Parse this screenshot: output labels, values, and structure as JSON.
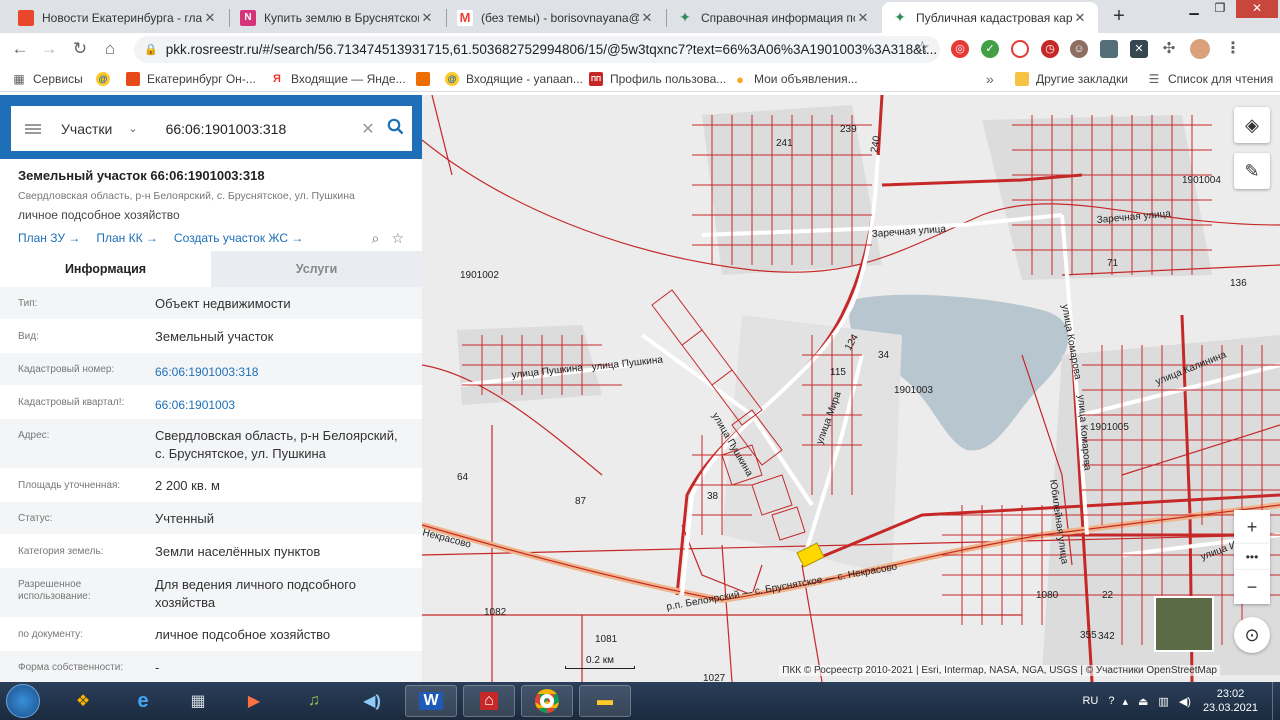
{
  "tabs": [
    {
      "title": "Новости Екатеринбурга - главн",
      "favicon": "news-favicon",
      "color": "#e8472b",
      "active": false
    },
    {
      "title": "Купить землю в Бруснятском -",
      "favicon": "cian-favicon",
      "color": "#d7337b",
      "active": false
    },
    {
      "title": "(без темы) - borisovnayana@gm",
      "favicon": "gmail-favicon",
      "color": "#ea4335",
      "active": false
    },
    {
      "title": "Справочная информация по об",
      "favicon": "rosreestr-favicon",
      "color": "#2e8b57",
      "active": false
    },
    {
      "title": "Публичная кадастровая карта",
      "favicon": "rosreestr-favicon",
      "color": "#2e8b57",
      "active": true
    }
  ],
  "address": {
    "url": "pkk.rosreestr.ru/#/search/56.713474513931715,61.503682752994806/15/@5w3tqxnc7?text=66%3A06%3A1901003%3A318&t..."
  },
  "bookmarks": [
    {
      "label": "Сервисы",
      "icon": "apps-icon"
    },
    {
      "label": "",
      "icon": "mail-at-icon"
    },
    {
      "label": "Екатеринбург Он-...",
      "icon": "e1-icon"
    },
    {
      "label": "Входящие — Янде...",
      "icon": "yandex-icon"
    },
    {
      "label": "",
      "icon": "orange-square-icon"
    },
    {
      "label": "Входящие - yanaan...",
      "icon": "mail-at-icon"
    },
    {
      "label": "Профиль пользова...",
      "icon": "pp-icon"
    },
    {
      "label": "Мои объявления...",
      "icon": "avito-icon"
    },
    {
      "label": "Другие закладки",
      "icon": "folder-icon"
    },
    {
      "label": "Список для чтения",
      "icon": "reading-list-icon"
    }
  ],
  "search": {
    "type": "Участки",
    "query": "66:06:1901003:318"
  },
  "object": {
    "title": "Земельный участок 66:06:1901003:318",
    "address": "Свердловская область, р-н Белоярский, с. Бруснятское, ул. Пушкина",
    "use": "личное подсобное хозяйство",
    "links": [
      "План ЗУ →",
      "План КК →",
      "Создать участок ЖС →"
    ]
  },
  "panel_tabs": {
    "info": "Информация",
    "services": "Услуги"
  },
  "info_rows": [
    {
      "k": "Тип:",
      "v": "Объект недвижимости",
      "link": false
    },
    {
      "k": "Вид:",
      "v": "Земельный участок",
      "link": false
    },
    {
      "k": "Кадастровый номер:",
      "v": "66:06:1901003:318",
      "link": true
    },
    {
      "k": "Кадастровый квартал!:",
      "v": "66:06:1901003",
      "link": true
    },
    {
      "k": "Адрес:",
      "v": "Свердловская область, р-н Белоярский, с. Бруснятское, ул. Пушкина",
      "link": false
    },
    {
      "k": "Площадь уточненная:",
      "v": "2 200 кв. м",
      "link": false
    },
    {
      "k": "Статус:",
      "v": "Учтенный",
      "link": false
    },
    {
      "k": "Категория земель:",
      "v": "Земли населённых пунктов",
      "link": false
    },
    {
      "k": "Разрешенное использование:",
      "v": "Для ведения личного подсобного хозяйства",
      "link": false
    },
    {
      "k": "по документу:",
      "v": "личное подсобное хозяйство",
      "link": false
    },
    {
      "k": "Форма собственности:",
      "v": "-",
      "link": false
    }
  ],
  "map": {
    "labels": [
      "1901002",
      "1901003",
      "1901004",
      "1901005",
      "улица Пушкина",
      "улица Пушкина",
      "Заречная улица",
      "Заречная улица",
      "улица Комарова",
      "улица Комарова",
      "улица Калинина",
      "улица Мира",
      "улица Пушкина",
      "Юбилейная улица",
      "улица Ильи",
      "р.п. Белоярский — с. Бруснятское — с. Некрасово",
      "Некрасово",
      "64",
      "87",
      "38",
      "1082",
      "1081",
      "1027",
      "1080",
      "241",
      "239",
      "240",
      "71",
      "136",
      "115",
      "124",
      "34",
      "355",
      "342",
      "22"
    ],
    "scale": "0.2 км",
    "attribution": "ПКК © Росреестр 2010-2021 | Esri, Intermap, NASA, NGA, USGS | © Участники OpenStreetMap"
  },
  "taskbar": {
    "lang": "RU",
    "time": "23:02",
    "date": "23.03.2021"
  }
}
